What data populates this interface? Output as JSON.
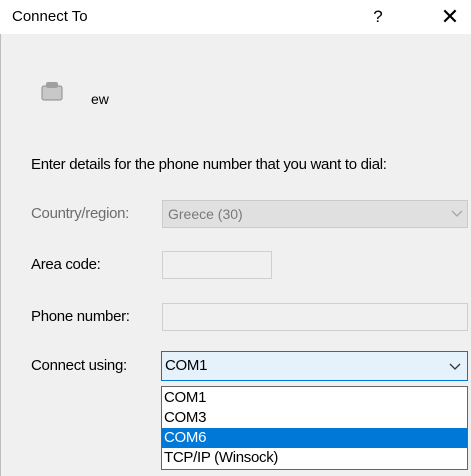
{
  "dialog": {
    "title": "Connect To",
    "help_label": "?",
    "close_label": "✕",
    "connection_name": "ew",
    "instruction": "Enter details for the phone number that you want to dial:"
  },
  "form": {
    "country_label": "Country/region:",
    "country_value": "Greece (30)",
    "area_code_label": "Area code:",
    "area_code_value": "",
    "phone_label": "Phone number:",
    "phone_value": "",
    "connect_label": "Connect using:",
    "connect_value": "COM1"
  },
  "dropdown": {
    "options": [
      "COM1",
      "COM3",
      "COM6",
      "TCP/IP (Winsock)"
    ],
    "highlighted": "COM6"
  },
  "colors": {
    "accent": "#0078d7",
    "selected_field_bg": "#e5f1fb"
  }
}
